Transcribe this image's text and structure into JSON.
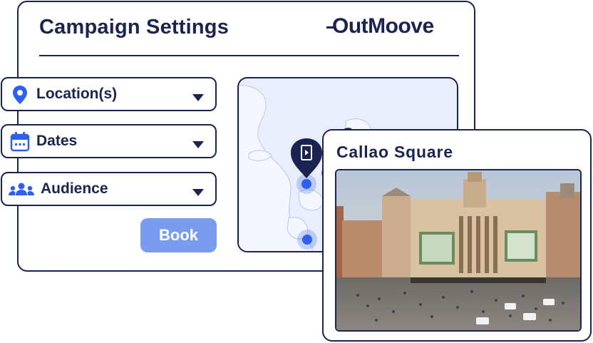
{
  "header": {
    "title": "Campaign Settings",
    "logo_text": "OutMoove"
  },
  "fields": [
    {
      "label": "Location(s)",
      "icon": "location-pin-icon"
    },
    {
      "label": "Dates",
      "icon": "calendar-icon"
    },
    {
      "label": "Audience",
      "icon": "audience-icon"
    }
  ],
  "book_button": {
    "label": "Book"
  },
  "popup": {
    "title": "Callao Square"
  },
  "colors": {
    "navy": "#1b2350",
    "blue": "#2f5ff0",
    "button": "#7a9cf0",
    "map_bg": "#e9eefc"
  }
}
